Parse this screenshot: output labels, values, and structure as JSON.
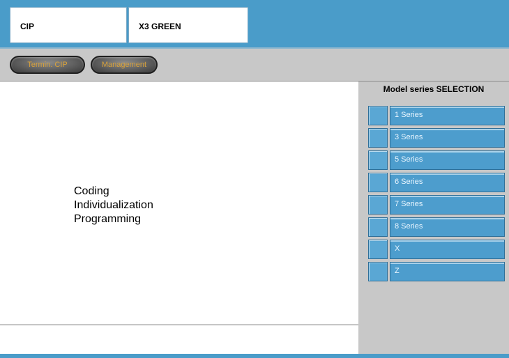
{
  "header": {
    "field1": "CIP",
    "field2": "X3 GREEN"
  },
  "toolbar": {
    "buttons": [
      "Termin. CIP",
      "Management"
    ]
  },
  "main": {
    "lines": [
      "Coding",
      "Individualization",
      "Programming"
    ]
  },
  "sidebar": {
    "title": "Model series SELECTION",
    "items": [
      {
        "label": "1 Series"
      },
      {
        "label": "3 Series"
      },
      {
        "label": "5 Series"
      },
      {
        "label": "6 Series"
      },
      {
        "label": "7 Series"
      },
      {
        "label": "8 Series"
      },
      {
        "label": "X"
      },
      {
        "label": "Z"
      }
    ]
  },
  "colors": {
    "accent_blue": "#4a9cc9",
    "panel_gray": "#c8c8c8",
    "button_text": "#d9a23a"
  }
}
